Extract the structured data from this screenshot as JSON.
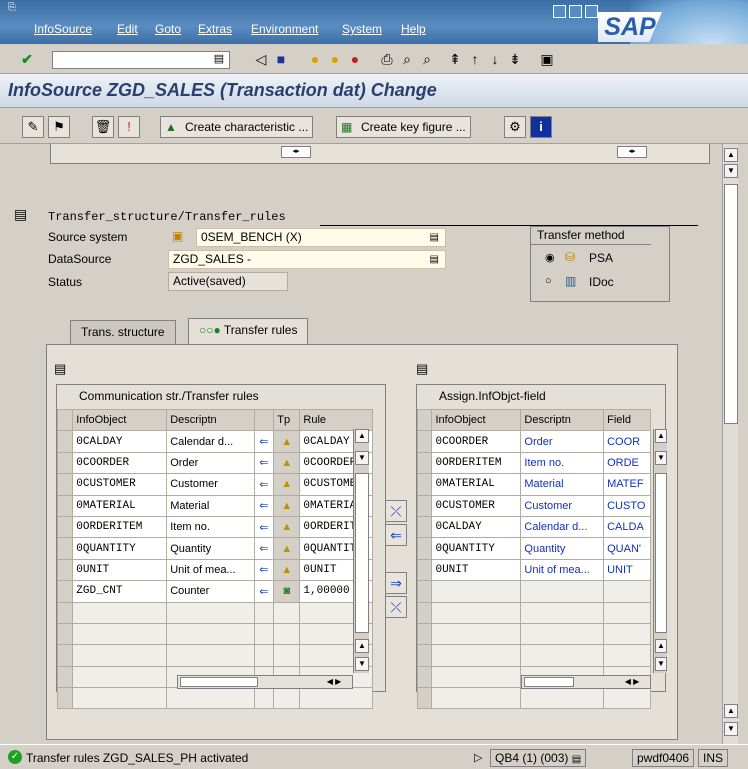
{
  "menu": [
    "InfoSource",
    "Edit",
    "Goto",
    "Extras",
    "Environment",
    "System",
    "Help"
  ],
  "brand": "SAP",
  "title": "InfoSource ZGD_SALES (Transaction dat) Change",
  "toolbar2": {
    "create_char": "Create characteristic ...",
    "create_kf": "Create key figure ..."
  },
  "section_title": "Transfer_structure/Transfer_rules",
  "source_system": {
    "label": "Source system",
    "value": "0SEM_BENCH (X)"
  },
  "datasource": {
    "label": "DataSource",
    "value": "ZGD_SALES -"
  },
  "status": {
    "label": "Status",
    "value": "Active(saved)"
  },
  "transfer_method": {
    "title": "Transfer method",
    "psa": "PSA",
    "idoc": "IDoc"
  },
  "tabs": {
    "trans_structure": "Trans. structure",
    "transfer_rules": "Transfer rules"
  },
  "left_table": {
    "title": "Communication str./Transfer rules",
    "headers": [
      "InfoObject",
      "Descriptn",
      "Tp",
      "Rule"
    ],
    "rows": [
      [
        "0CALDAY",
        "Calendar d...",
        "0CALDAY"
      ],
      [
        "0COORDER",
        "Order",
        "0COORDER"
      ],
      [
        "0CUSTOMER",
        "Customer",
        "0CUSTOMEI"
      ],
      [
        "0MATERIAL",
        "Material",
        "0MATERIAI"
      ],
      [
        "0ORDERITEM",
        "Item no.",
        "0ORDERITI"
      ],
      [
        "0QUANTITY",
        "Quantity",
        "0QUANTIT'"
      ],
      [
        "0UNIT",
        "Unit of mea...",
        "0UNIT"
      ],
      [
        "ZGD_CNT",
        "Counter",
        "1,00000"
      ]
    ]
  },
  "right_table": {
    "title": "Assign.InfObjct-field",
    "headers": [
      "InfoObject",
      "Descriptn",
      "Field"
    ],
    "rows": [
      [
        "0COORDER",
        "Order",
        "COOR"
      ],
      [
        "0ORDERITEM",
        "Item no.",
        "ORDE"
      ],
      [
        "0MATERIAL",
        "Material",
        "MATEF"
      ],
      [
        "0CUSTOMER",
        "Customer",
        "CUSTO"
      ],
      [
        "0CALDAY",
        "Calendar d...",
        "CALDA"
      ],
      [
        "0QUANTITY",
        "Quantity",
        "QUAN'"
      ],
      [
        "0UNIT",
        "Unit of mea...",
        "UNIT"
      ]
    ]
  },
  "statusbar": {
    "message": "Transfer rules ZGD_SALES_PH activated",
    "system": "QB4 (1) (003)",
    "server": "pwdf0406",
    "mode": "INS"
  }
}
